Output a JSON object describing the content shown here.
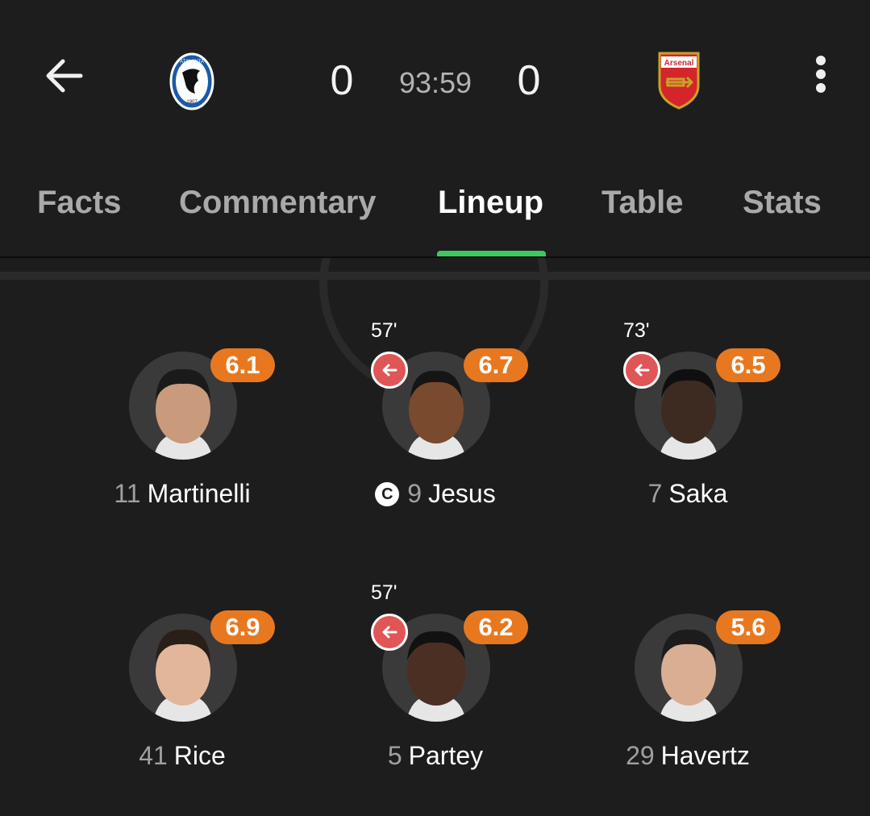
{
  "match": {
    "home_score": "0",
    "away_score": "0",
    "clock": "93:59",
    "home_crest": "atalanta-crest",
    "away_crest": "arsenal-crest",
    "away_crest_text": "Arsenal",
    "home_crest_text": "ATALANTA",
    "home_crest_year": "1907"
  },
  "tabs": [
    {
      "label": "Facts",
      "active": false
    },
    {
      "label": "Commentary",
      "active": false
    },
    {
      "label": "Lineup",
      "active": true
    },
    {
      "label": "Table",
      "active": false
    },
    {
      "label": "Stats",
      "active": false
    }
  ],
  "colors": {
    "background": "#1d1d1d",
    "rating_badge": "#e8781f",
    "sub_off": "#e05555",
    "tab_indicator": "#3cc962"
  },
  "players": [
    {
      "number": "11",
      "name": "Martinelli",
      "rating": "6.1",
      "sub_time": "",
      "captain": false
    },
    {
      "number": "9",
      "name": "Jesus",
      "rating": "6.7",
      "sub_time": "57'",
      "captain": true,
      "captain_label": "C"
    },
    {
      "number": "7",
      "name": "Saka",
      "rating": "6.5",
      "sub_time": "73'",
      "captain": false
    },
    {
      "number": "41",
      "name": "Rice",
      "rating": "6.9",
      "sub_time": "",
      "captain": false
    },
    {
      "number": "5",
      "name": "Partey",
      "rating": "6.2",
      "sub_time": "57'",
      "captain": false
    },
    {
      "number": "29",
      "name": "Havertz",
      "rating": "5.6",
      "sub_time": "",
      "captain": false
    }
  ]
}
